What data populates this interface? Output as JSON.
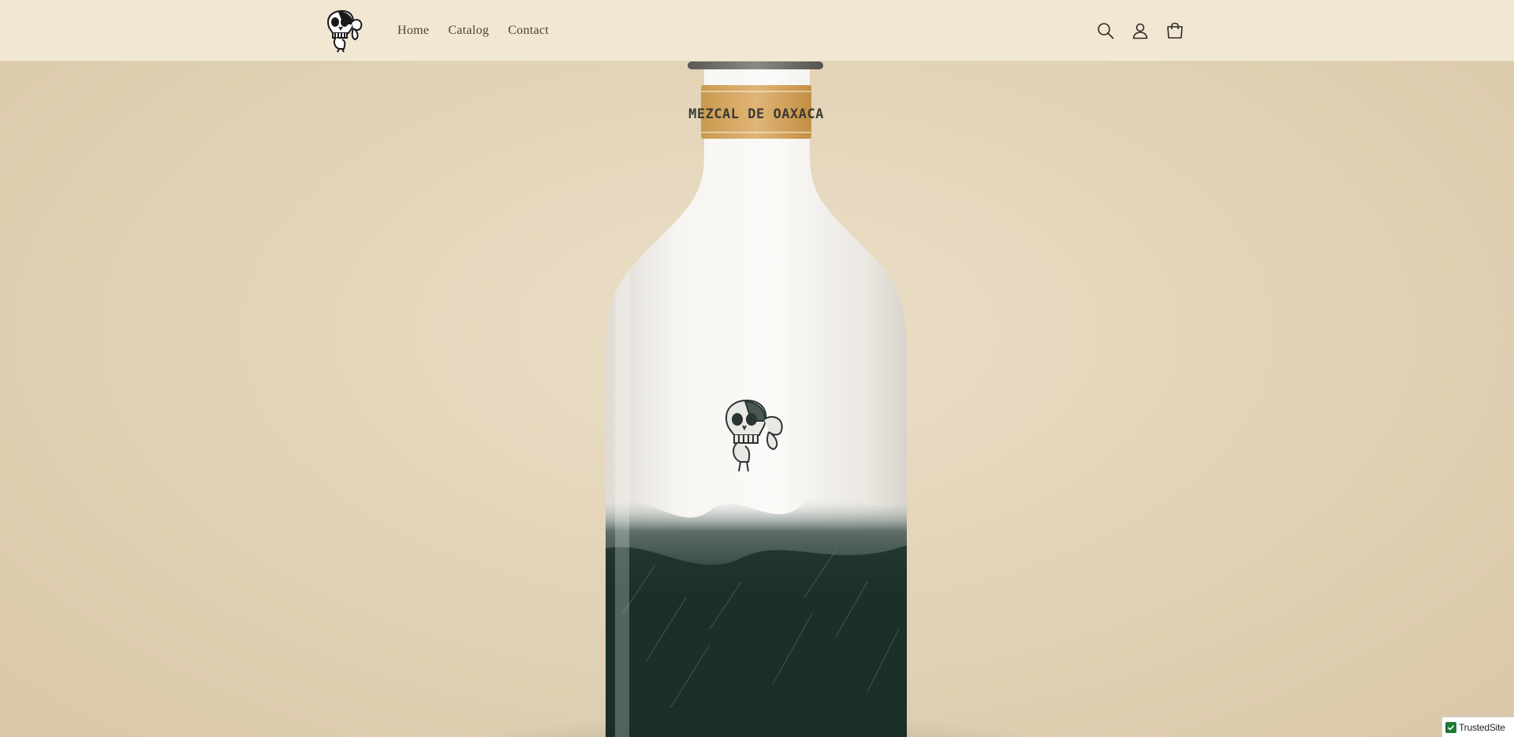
{
  "header": {
    "logo_icon": "skull-mascot-logo",
    "nav": [
      {
        "label": "Home"
      },
      {
        "label": "Catalog"
      },
      {
        "label": "Contact"
      }
    ],
    "icons": [
      "search-icon",
      "account-icon",
      "cart-icon"
    ]
  },
  "hero": {
    "image": "frosted mezcal bottle with skull emblem",
    "neck_label": "MEZCAL DE OAXACA"
  },
  "badge": {
    "text": "TrustedSite"
  },
  "colors": {
    "header_bg": "#f2e7d3",
    "hero_bg": "#e2d4b9",
    "text": "#4a4438",
    "bottle_dark": "#1f3a33",
    "badge_green": "#1d7a34"
  }
}
